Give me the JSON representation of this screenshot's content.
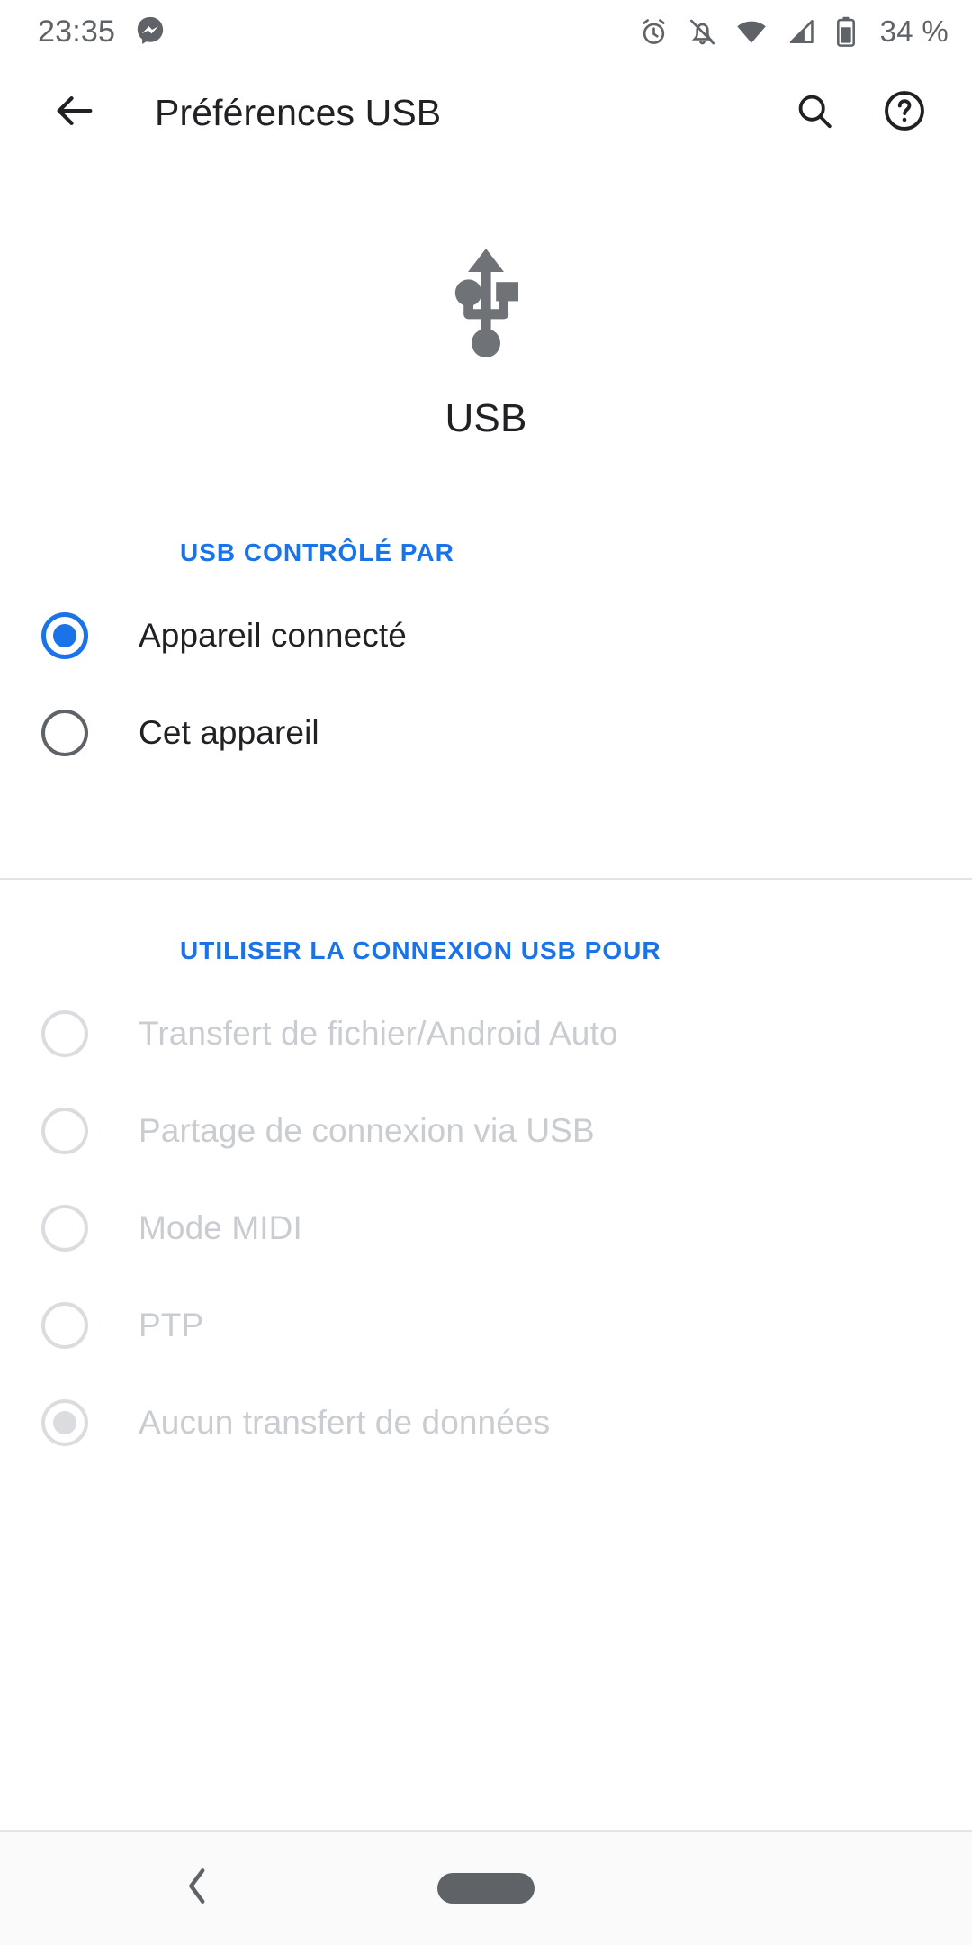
{
  "status_bar": {
    "time": "23:35",
    "battery_percent": "34 %",
    "icons": {
      "messenger": "messenger-icon",
      "alarm": "alarm-icon",
      "notifications_muted": "bell-muted-icon",
      "wifi": "wifi-icon",
      "signal": "cell-signal-icon",
      "battery": "battery-icon"
    }
  },
  "app_bar": {
    "back_label": "back-arrow",
    "title": "Préférences USB",
    "search_label": "search-icon",
    "help_label": "help-icon"
  },
  "hero": {
    "icon": "usb-icon",
    "label": "USB"
  },
  "sections": [
    {
      "title": "USB CONTRÔLÉ PAR",
      "enabled": true,
      "options": [
        {
          "label": "Appareil connecté",
          "checked": true,
          "disabled": false
        },
        {
          "label": "Cet appareil",
          "checked": false,
          "disabled": false
        }
      ]
    },
    {
      "title": "UTILISER LA CONNEXION USB POUR",
      "enabled": false,
      "options": [
        {
          "label": "Transfert de fichier/Android Auto",
          "checked": false,
          "disabled": true
        },
        {
          "label": "Partage de connexion via USB",
          "checked": false,
          "disabled": true
        },
        {
          "label": "Mode MIDI",
          "checked": false,
          "disabled": true
        },
        {
          "label": "PTP",
          "checked": false,
          "disabled": true
        },
        {
          "label": "Aucun transfert de données",
          "checked": true,
          "disabled": true
        }
      ]
    }
  ],
  "nav_bar": {
    "back": "nav-back-chevron",
    "home": "nav-home-pill"
  },
  "colors": {
    "accent_blue": "#1a73e8",
    "text_primary": "#202124",
    "text_disabled": "#c9ccd0",
    "icon_grey": "#5f6368",
    "divider": "#e3e4e8"
  }
}
